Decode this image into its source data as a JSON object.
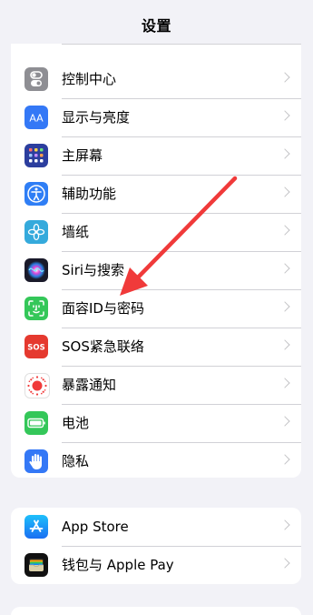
{
  "header": {
    "title": "设置"
  },
  "main_group": {
    "rows": [
      {
        "label": "控制中心",
        "icon": "control-center-icon",
        "color": "#8e8e93"
      },
      {
        "label": "显示与亮度",
        "icon": "display-brightness-icon",
        "color": "#3478f6"
      },
      {
        "label": "主屏幕",
        "icon": "home-screen-icon",
        "color": "#2c3e9e"
      },
      {
        "label": "辅助功能",
        "icon": "accessibility-icon",
        "color": "#2f7ef5"
      },
      {
        "label": "墙纸",
        "icon": "wallpaper-icon",
        "color": "#35aadc"
      },
      {
        "label": "Siri与搜索",
        "icon": "siri-icon",
        "color": "#1a1a2a"
      },
      {
        "label": "面容ID与密码",
        "icon": "face-id-icon",
        "color": "#34c759"
      },
      {
        "label": "SOS紧急联络",
        "icon": "sos-icon",
        "icon_text": "SOS",
        "color": "#e5392f"
      },
      {
        "label": "暴露通知",
        "icon": "exposure-notification-icon",
        "color": "#ffffff"
      },
      {
        "label": "电池",
        "icon": "battery-icon",
        "color": "#34c759"
      },
      {
        "label": "隐私",
        "icon": "privacy-hand-icon",
        "color": "#3478f6"
      }
    ]
  },
  "store_group": {
    "rows": [
      {
        "label": "App Store",
        "icon": "app-store-icon",
        "color": "#1a8cf2"
      },
      {
        "label": "钱包与 Apple Pay",
        "icon": "wallet-icon",
        "color": "#111111"
      }
    ]
  },
  "annotation": {
    "arrow_color": "#f03a3a"
  }
}
